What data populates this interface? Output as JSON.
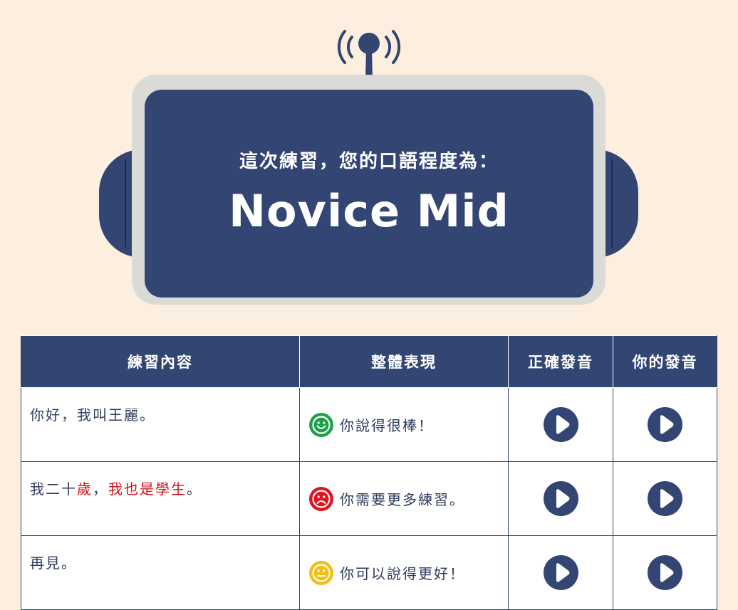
{
  "card": {
    "subtitle": "這次練習，您的口語程度為：",
    "level": "Novice Mid"
  },
  "table": {
    "headers": [
      "練習內容",
      "整體表現",
      "正確發音",
      "你的發音"
    ],
    "rows": [
      {
        "sentence": [
          {
            "text": "你好，我叫王麗。",
            "highlight": false
          }
        ],
        "rating": "good",
        "feedback": "你說得很棒！"
      },
      {
        "sentence": [
          {
            "text": "我二十",
            "highlight": false
          },
          {
            "text": "歲",
            "highlight": true
          },
          {
            "text": "，",
            "highlight": false
          },
          {
            "text": "我也是學生",
            "highlight": true
          },
          {
            "text": "。",
            "highlight": false
          }
        ],
        "rating": "bad",
        "feedback": "你需要更多練習。"
      },
      {
        "sentence": [
          {
            "text": "再見。",
            "highlight": false
          }
        ],
        "rating": "ok",
        "feedback": "你可以說得更好！"
      }
    ]
  },
  "icons": {
    "antenna": "antenna-icon",
    "good": "smiley-happy-icon",
    "bad": "smiley-sad-icon",
    "ok": "smiley-neutral-icon",
    "play": "play-icon"
  },
  "colors": {
    "background": "#fcefdf",
    "navy": "#334572",
    "highlight": "#d0121b",
    "good": "#1fa04a",
    "bad": "#e0151f",
    "ok": "#f2bf15"
  }
}
